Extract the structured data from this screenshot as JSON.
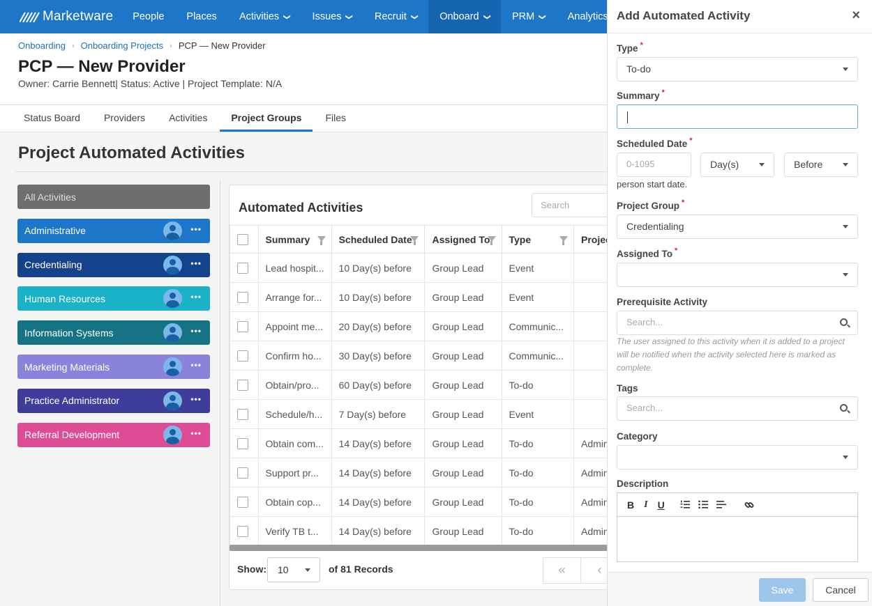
{
  "nav": {
    "brand": "Marketware",
    "items": [
      {
        "label": "People",
        "dropdown": false,
        "active": false
      },
      {
        "label": "Places",
        "dropdown": false,
        "active": false
      },
      {
        "label": "Activities",
        "dropdown": true,
        "active": false
      },
      {
        "label": "Issues",
        "dropdown": true,
        "active": false
      },
      {
        "label": "Recruit",
        "dropdown": true,
        "active": false
      },
      {
        "label": "Onboard",
        "dropdown": true,
        "active": true
      },
      {
        "label": "PRM",
        "dropdown": true,
        "active": false
      },
      {
        "label": "Analytics",
        "dropdown": false,
        "active": false
      }
    ]
  },
  "breadcrumb": [
    "Onboarding",
    "Onboarding Projects",
    "PCP — New Provider"
  ],
  "page": {
    "title": "PCP — New Provider",
    "subtitle": "Owner: Carrie Bennett| Status: Active | Project Template: N/A"
  },
  "tabs": [
    "Status Board",
    "Providers",
    "Activities",
    "Project Groups",
    "Files"
  ],
  "active_tab": "Project Groups",
  "section_title": "Project Automated Activities",
  "groups": [
    {
      "label": "All Activities",
      "color": "#6e6e6e"
    },
    {
      "label": "Administrative",
      "color": "#1e76c8"
    },
    {
      "label": "Credentialing",
      "color": "#14428c"
    },
    {
      "label": "Human Resources",
      "color": "#1ab2c7"
    },
    {
      "label": "Information Systems",
      "color": "#167386"
    },
    {
      "label": "Marketing Materials",
      "color": "#8a83dc"
    },
    {
      "label": "Practice Administrator",
      "color": "#3f3d9c"
    },
    {
      "label": "Referral Development",
      "color": "#df4c96"
    }
  ],
  "table": {
    "title": "Automated Activities",
    "search_placeholder": "Search",
    "columns": [
      "Summary",
      "Scheduled Date",
      "Assigned To",
      "Type",
      "Projec"
    ],
    "rows": [
      [
        "Lead hospit...",
        "10 Day(s) before",
        "Group Lead",
        "Event",
        ""
      ],
      [
        "Arrange for...",
        "10 Day(s) before",
        "Group Lead",
        "Event",
        ""
      ],
      [
        "Appoint me...",
        "20 Day(s) before",
        "Group Lead",
        "Communic...",
        ""
      ],
      [
        "Confirm ho...",
        "30 Day(s) before",
        "Group Lead",
        "Communic...",
        ""
      ],
      [
        "Obtain/pro...",
        "60 Day(s) before",
        "Group Lead",
        "To-do",
        ""
      ],
      [
        "Schedule/h...",
        "7 Day(s) before",
        "Group Lead",
        "Event",
        ""
      ],
      [
        "Obtain com...",
        "14 Day(s) before",
        "Group Lead",
        "To-do",
        "Admin"
      ],
      [
        "Support pr...",
        "14 Day(s) before",
        "Group Lead",
        "To-do",
        "Admin"
      ],
      [
        "Obtain cop...",
        "14 Day(s) before",
        "Group Lead",
        "To-do",
        "Admin"
      ],
      [
        "Verify TB t...",
        "14 Day(s) before",
        "Group Lead",
        "To-do",
        "Admin"
      ]
    ],
    "show_label": "Show:",
    "page_size": "10",
    "records_label": "of 81 Records",
    "first_page": "«",
    "prev_page": "‹"
  },
  "drawer": {
    "title": "Add Automated Activity",
    "close": "×",
    "type_label": "Type",
    "type_value": "To-do",
    "summary_label": "Summary",
    "summary_value": "",
    "scheduled_label": "Scheduled Date",
    "scheduled_placeholder": "0-1095",
    "unit_value": "Day(s)",
    "relation_value": "Before",
    "scheduled_helper": "person start date.",
    "group_label": "Project Group",
    "group_value": "Credentialing",
    "assigned_label": "Assigned To",
    "assigned_value": "",
    "prereq_label": "Prerequisite Activity",
    "prereq_placeholder": "Search...",
    "prereq_helper": "The user assigned to this activity when it is added to a project will be notified when the activity selected here is marked as complete.",
    "tags_label": "Tags",
    "tags_placeholder": "Search...",
    "category_label": "Category",
    "category_value": "",
    "description_label": "Description",
    "toolbar": {
      "bold": "B",
      "italic": "I",
      "underline": "U"
    },
    "save_label": "Save",
    "cancel_label": "Cancel"
  }
}
